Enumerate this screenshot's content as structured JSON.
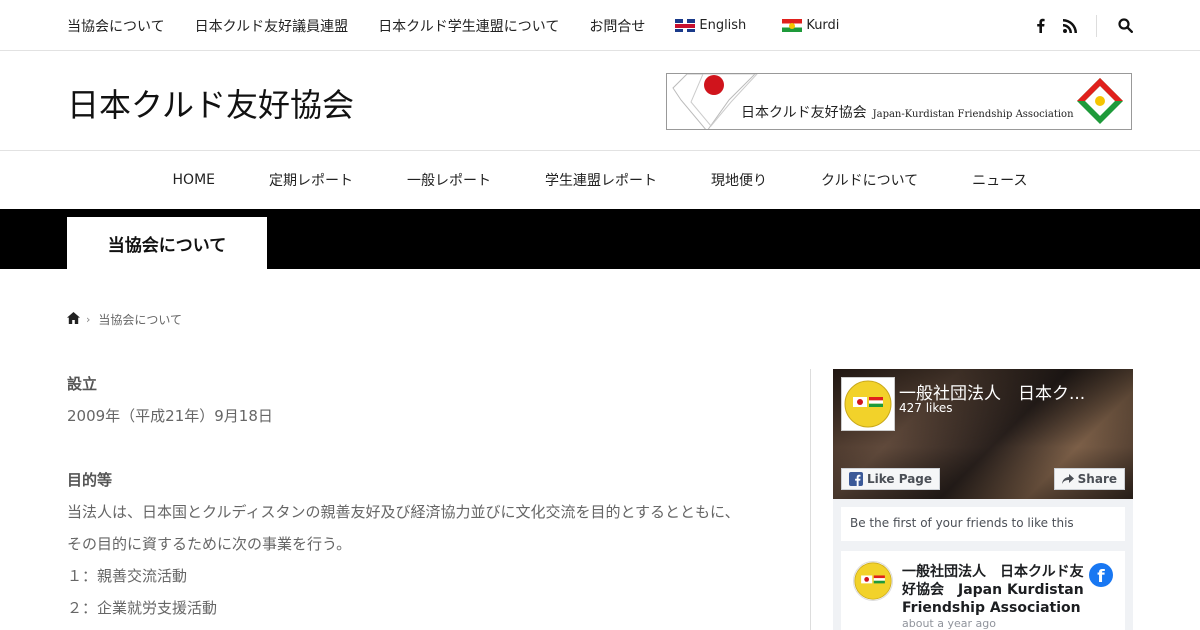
{
  "topnav": {
    "items": [
      "当協会について",
      "日本クルド友好議員連盟",
      "日本クルド学生連盟について",
      "お問合せ"
    ],
    "languages": [
      {
        "label": "English",
        "flag": "uk-flag-icon"
      },
      {
        "label": "Kurdi",
        "flag": "kurdistan-flag-icon"
      }
    ],
    "icons": [
      "facebook-icon",
      "rss-icon",
      "search-icon"
    ]
  },
  "header": {
    "site_title": "日本クルド友好協会",
    "banner_jp": "日本クルド友好協会",
    "banner_en": "Japan-Kurdistan Friendship Association"
  },
  "mainnav": {
    "items": [
      "HOME",
      "定期レポート",
      "一般レポート",
      "学生連盟レポート",
      "現地便り",
      "クルドについて",
      "ニュース"
    ]
  },
  "page": {
    "tab_title": "当協会について",
    "breadcrumb_current": "当協会について"
  },
  "content": {
    "lines": [
      {
        "text": "設立",
        "bold": true
      },
      {
        "text": "2009年（平成21年）9月18日",
        "bold": false
      },
      {
        "text": "",
        "bold": false
      },
      {
        "text": "目的等",
        "bold": true
      },
      {
        "text": "当法人は、日本国とクルディスタンの親善友好及び経済協力並びに文化交流を目的とするとともに、",
        "bold": false
      },
      {
        "text": "その目的に資するために次の事業を行う。",
        "bold": false
      },
      {
        "text": "１：親善交流活動",
        "bold": false
      },
      {
        "text": "２：企業就労支援活動",
        "bold": false
      }
    ]
  },
  "facebook": {
    "page_name": "一般社団法人　日本ク...",
    "likes": "427 likes",
    "like_label": "Like Page",
    "share_label": "Share",
    "friends_text": "Be the first of your friends to like this",
    "post_name": "一般社団法人　日本クルド友好協会　Japan Kurdistan Friendship Association",
    "post_time": "about a year ago",
    "brand_color": "#1877f2"
  },
  "colors": {
    "band": "#000000",
    "text": "#222222",
    "muted": "#666666"
  }
}
